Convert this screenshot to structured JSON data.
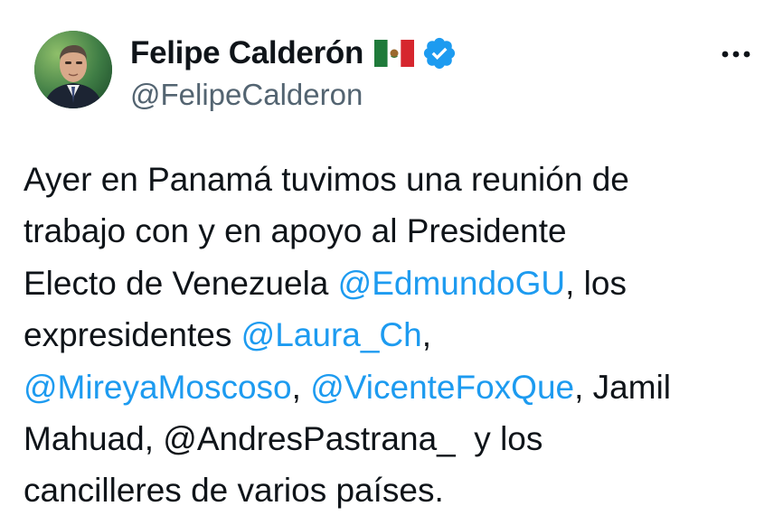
{
  "user": {
    "display_name": "Felipe Calderón",
    "handle": "@FelipeCalderon",
    "verified": true,
    "flag": "mexico-flag",
    "avatar": "profile-photo"
  },
  "more_icon": "more-horizontal-icon",
  "colors": {
    "text": "#0f1419",
    "secondary": "#536471",
    "link": "#1d9bf0",
    "verified": "#1d9bf0"
  },
  "tweet": {
    "lines": [
      [
        {
          "t": "Ayer en Panamá tuvimos una reunión de"
        }
      ],
      [
        {
          "t": "trabajo con y en apoyo al Presidente"
        }
      ],
      [
        {
          "t": "Electo de Venezuela "
        },
        {
          "t": "@EdmundoGU",
          "m": true
        },
        {
          "t": ", los"
        }
      ],
      [
        {
          "t": "expresidentes "
        },
        {
          "t": "@Laura_Ch",
          "m": true
        },
        {
          "t": ","
        }
      ],
      [
        {
          "t": "@MireyaMoscoso",
          "m": true
        },
        {
          "t": ", "
        },
        {
          "t": "@VicenteFoxQue",
          "m": true
        },
        {
          "t": ", Jamil"
        }
      ],
      [
        {
          "t": "Mahuad, @AndresPastrana_  y los"
        }
      ],
      [
        {
          "t": "cancilleres de varios países."
        }
      ]
    ]
  }
}
